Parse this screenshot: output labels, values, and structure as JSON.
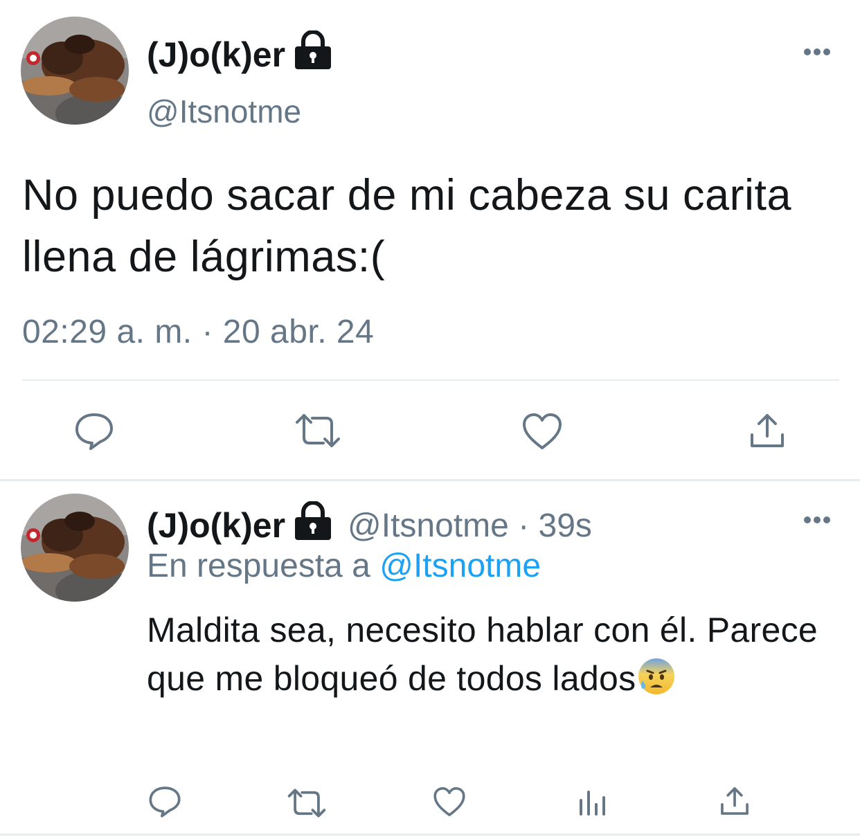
{
  "tweet": {
    "author": {
      "name": "(J)o(k)er",
      "handle": "@Itsnotme"
    },
    "text": "No puedo sacar de mi cabeza su carita llena de lágrimas:(",
    "timestamp": "02:29 a. m. · 20 abr. 24",
    "icons": {
      "reply": "reply-icon",
      "retweet": "retweet-icon",
      "like": "heart-icon",
      "share": "share-icon",
      "more": "more-icon",
      "lock": "lock-icon"
    }
  },
  "reply": {
    "author": {
      "name": "(J)o(k)er",
      "handle": "@Itsnotme"
    },
    "age": "39s",
    "separator": "·",
    "replying_prefix": "En respuesta a",
    "replying_to": "@Itsnotme",
    "text": "Maldita sea, necesito hablar con él. Parece que me bloqueó de todos lados",
    "emoji": "anxious-face-with-sweat",
    "icons": {
      "reply": "reply-icon",
      "retweet": "retweet-icon",
      "like": "heart-icon",
      "analytics": "analytics-icon",
      "share": "share-icon"
    }
  },
  "colors": {
    "text": "#14171a",
    "secondary": "#657786",
    "link": "#1da1f2",
    "divider": "#e6ecf0"
  }
}
